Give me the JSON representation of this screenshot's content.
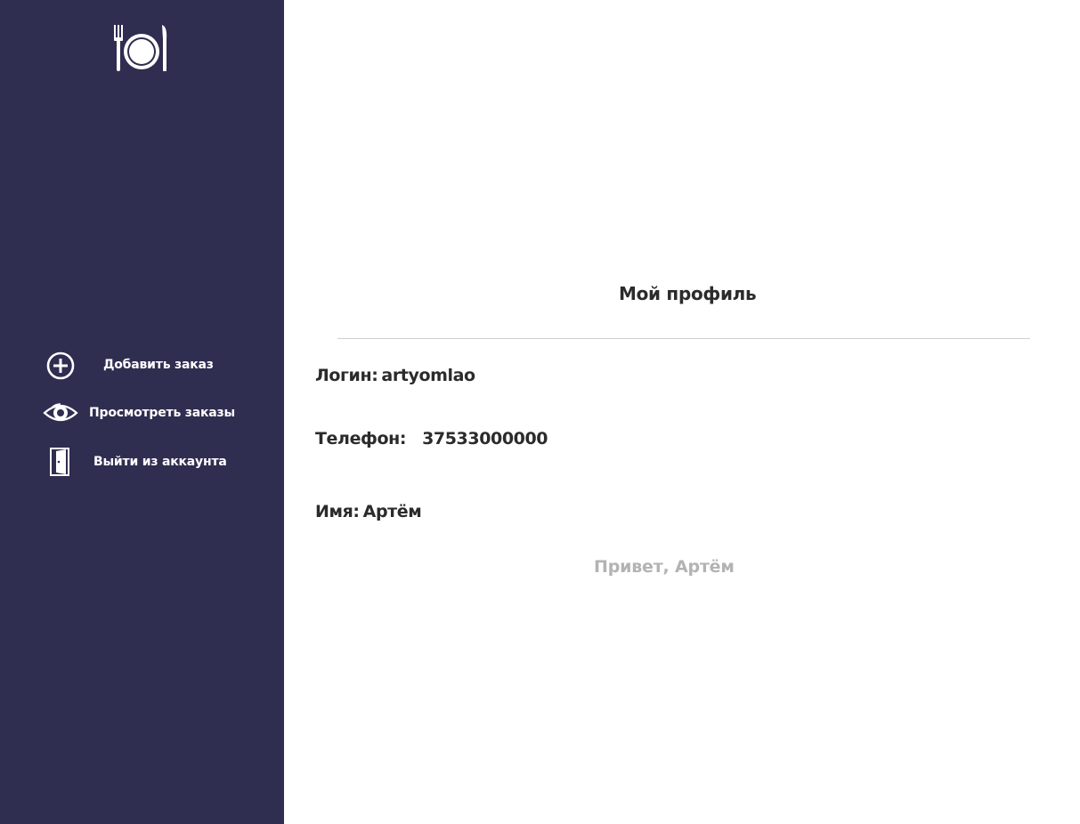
{
  "sidebar": {
    "logo_icon": "fork-plate-knife-icon",
    "items": [
      {
        "label": "Добавить заказ",
        "icon": "plus-circle-icon"
      },
      {
        "label": "Просмотреть заказы",
        "icon": "eye-icon"
      },
      {
        "label": "Выйти из аккаунта",
        "icon": "door-exit-icon"
      }
    ]
  },
  "profile": {
    "title": "Мой профиль",
    "login_label": "Логин:",
    "login_value": "artyomlao",
    "phone_label": "Телефон:",
    "phone_value": "37533000000",
    "name_label": "Имя:",
    "name_value": "Артём",
    "greeting": "Привет,  Артём"
  },
  "colors": {
    "sidebar_bg": "#2f2d50",
    "main_bg": "#ffffff",
    "text_dark": "#2b2b2b",
    "greeting_text": "#b3b3b3",
    "divider": "#cfcfcf"
  }
}
